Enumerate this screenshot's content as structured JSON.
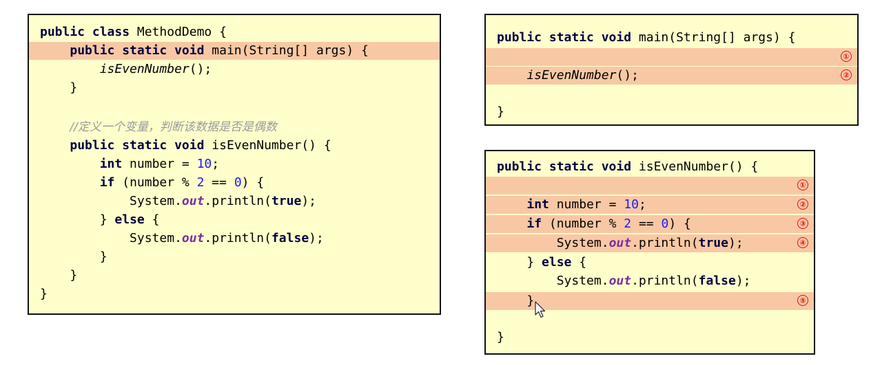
{
  "left_panel": {
    "class_open_kw": "public class",
    "class_name": " MethodDemo {",
    "main_sig_kw": "public static void",
    "main_sig_rest": " main(String[] args) {",
    "main_call": "isEvenNumber",
    "main_call_suffix": "();",
    "close_brace": "}",
    "comment": "//定义一个变量，判断该数据是否是偶数",
    "method_sig_kw": "public static void",
    "method_sig_rest": " isEvenNumber() {",
    "int_kw": "int",
    "number_decl": " number = ",
    "number_value": "10",
    "semicolon": ";",
    "if_kw": "if",
    "if_open": " (number % ",
    "mod_value": "2",
    "eq_text": " == ",
    "zero_value": "0",
    "if_close": ") {",
    "system_text": "System.",
    "out_text": "out",
    "println_text": ".println(",
    "true_kw": "true",
    "false_kw": "false",
    "println_close": ");",
    "else_open": "} ",
    "else_kw": "else",
    "else_brace": " {"
  },
  "top_right_panel": {
    "main_sig_kw": "public static void",
    "main_sig_rest": " main(String[] args) {",
    "main_call": "isEvenNumber",
    "main_call_suffix": "();",
    "close_brace": "}",
    "markers": [
      "①",
      "②"
    ]
  },
  "bottom_right_panel": {
    "method_sig_kw": "public static void",
    "method_sig_rest": " isEvenNumber() {",
    "int_kw": "int",
    "number_decl": " number = ",
    "number_value": "10",
    "semicolon": ";",
    "if_kw": "if",
    "if_open": " (number % ",
    "mod_value": "2",
    "eq_text": " == ",
    "zero_value": "0",
    "if_close": ") {",
    "system_text": "System.",
    "out_text": "out",
    "println_text": ".println(",
    "true_kw": "true",
    "false_kw": "false",
    "println_close": ");",
    "else_open": "} ",
    "else_kw": "else",
    "else_brace": " {",
    "close_brace": "}",
    "markers": [
      "①",
      "②",
      "③",
      "④",
      "⑤"
    ]
  }
}
